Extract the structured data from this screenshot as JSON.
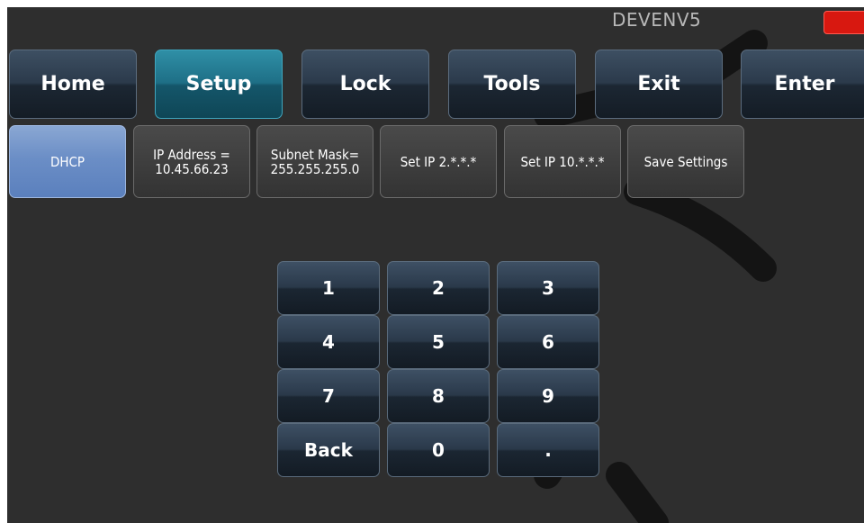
{
  "window": {
    "title": "DEVENV5"
  },
  "status": {
    "color": "#d81810"
  },
  "nav": {
    "home": "Home",
    "setup": "Setup",
    "lock": "Lock",
    "tools": "Tools",
    "exit": "Exit",
    "enter": "Enter"
  },
  "network": {
    "dhcp": "DHCP",
    "ip_label": "IP Address =",
    "ip_value": "10.45.66.23",
    "mask_label": "Subnet Mask=",
    "mask_value": "255.255.255.0",
    "set_ip_2": "Set IP 2.*.*.*",
    "set_ip_10": "Set IP 10.*.*.*",
    "save": "Save Settings"
  },
  "keypad": {
    "k1": "1",
    "k2": "2",
    "k3": "3",
    "k4": "4",
    "k5": "5",
    "k6": "6",
    "k7": "7",
    "k8": "8",
    "k9": "9",
    "back": "Back",
    "k0": "0",
    "dot": "."
  },
  "watermark_icon": "diagonal-stroke-watermark",
  "colors": {
    "accent": "#1e6f86",
    "dhcp": "#6b8ec6",
    "background": "#2e2e2e"
  }
}
